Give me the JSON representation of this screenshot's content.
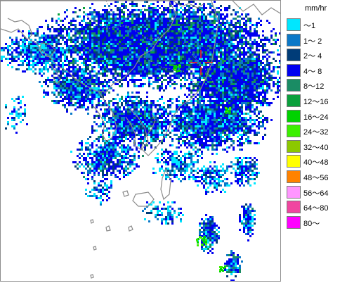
{
  "map": {
    "subject": "Radar precipitation intensity map over southern Kyushu and nearby islands",
    "marker": "red crosshair"
  },
  "legend": {
    "unit": "mm/hr",
    "items": [
      {
        "label": "～1",
        "color": "#00e7ff"
      },
      {
        "label": "1～ 2",
        "color": "#0a78c8"
      },
      {
        "label": "2～ 4",
        "color": "#003c78"
      },
      {
        "label": "4～ 8",
        "color": "#0000f0"
      },
      {
        "label": "8～12",
        "color": "#1a8c64"
      },
      {
        "label": "12～16",
        "color": "#0aa03c"
      },
      {
        "label": "16～24",
        "color": "#00d200"
      },
      {
        "label": "24～32",
        "color": "#3cf000"
      },
      {
        "label": "32～40",
        "color": "#8cc800"
      },
      {
        "label": "40～48",
        "color": "#ffff00"
      },
      {
        "label": "48～56",
        "color": "#ff8200"
      },
      {
        "label": "56～64",
        "color": "#ff96ff"
      },
      {
        "label": "64～80",
        "color": "#f046a0"
      },
      {
        "label": "80～",
        "color": "#ff00ff"
      }
    ]
  }
}
